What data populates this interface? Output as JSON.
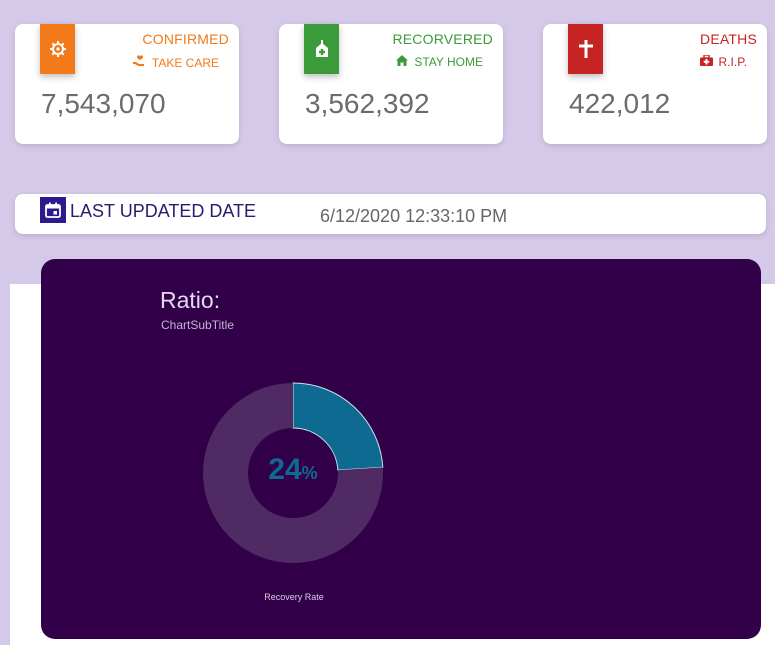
{
  "cards": {
    "confirmed": {
      "title": "CONFIRMED",
      "sub": "TAKE CARE",
      "value": "7,543,070",
      "color": "#f27a1a",
      "icon": "virus-icon",
      "sub_icon": "hand-heart-icon"
    },
    "recovered": {
      "title": "RECORVERED",
      "sub": "STAY HOME",
      "value": "3,562,392",
      "color": "#3b9a3a",
      "icon": "hospital-icon",
      "sub_icon": "home-icon"
    },
    "deaths": {
      "title": "DEATHS",
      "sub": "R.I.P.",
      "value": "422,012",
      "color": "#c62323",
      "icon": "cross-icon",
      "sub_icon": "medical-kit-icon"
    }
  },
  "last_updated": {
    "label": "LAST UPDATED DATE",
    "value": "6/12/2020 12:33:10 PM",
    "icon": "calendar-icon"
  },
  "chart_data": {
    "type": "pie",
    "title": "Ratio:",
    "subtitle": "ChartSubTitle",
    "center_value": "24",
    "center_unit": "%",
    "series": [
      {
        "name": "Recovery Rate",
        "values": [
          24,
          76
        ]
      }
    ],
    "slice_colors": [
      "#0e6a91",
      "#4f2a63"
    ]
  }
}
